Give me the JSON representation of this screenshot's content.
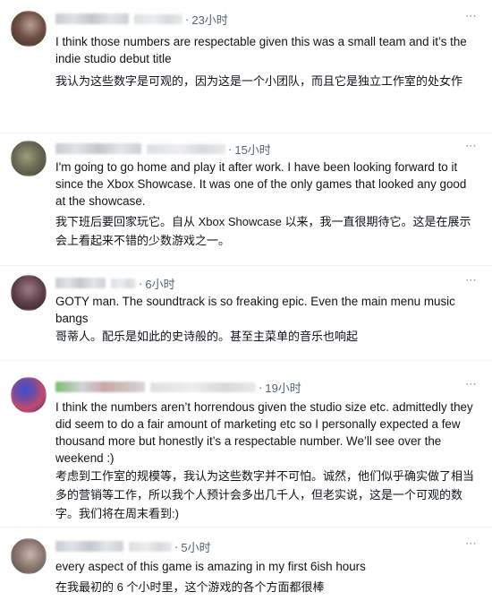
{
  "more_icon": "more-dots-icon",
  "posts": [
    {
      "time": "23小时",
      "text": "I think those numbers are respectable given this was a small team and it’s the indie studio debut title",
      "translation": "我认为这些数字是可观的，因为这是一个小团队，而且它是独立工作室的处女作"
    },
    {
      "time": "15小时",
      "text": "I'm going to go home and play it after work. I have been looking forward to it since the Xbox Showcase. It was one of the only games that looked any good at the showcase.",
      "translation": "我下班后要回家玩它。自从 Xbox Showcase 以来，我一直很期待它。这是在展示会上看起来不错的少数游戏之一。"
    },
    {
      "time": "6小时",
      "text": "GOTY man. The soundtrack is so freaking epic. Even the main menu music bangs",
      "translation": "哥蒂人。配乐是如此的史诗般的。甚至主菜单的音乐也响起"
    },
    {
      "time": "19小时",
      "text": "I think the numbers aren’t horrendous given the studio size etc. admittedly they did seem to do a fair amount of marketing etc so I personally expected a few thousand more but honestly it’s a respectable number. We’ll see over the weekend :)",
      "translation": "考虑到工作室的规模等，我认为这些数字并不可怕。诚然，他们似乎确实做了相当多的营销等工作，所以我个人预计会多出几千人，但老实说，这是一个可观的数字。我们将在周末看到:)"
    },
    {
      "time": "5小时",
      "text": "every aspect of this game is amazing in my first 6ish hours",
      "translation": "在我最初的 6 个小时里，这个游戏的各个方面都很棒"
    }
  ]
}
